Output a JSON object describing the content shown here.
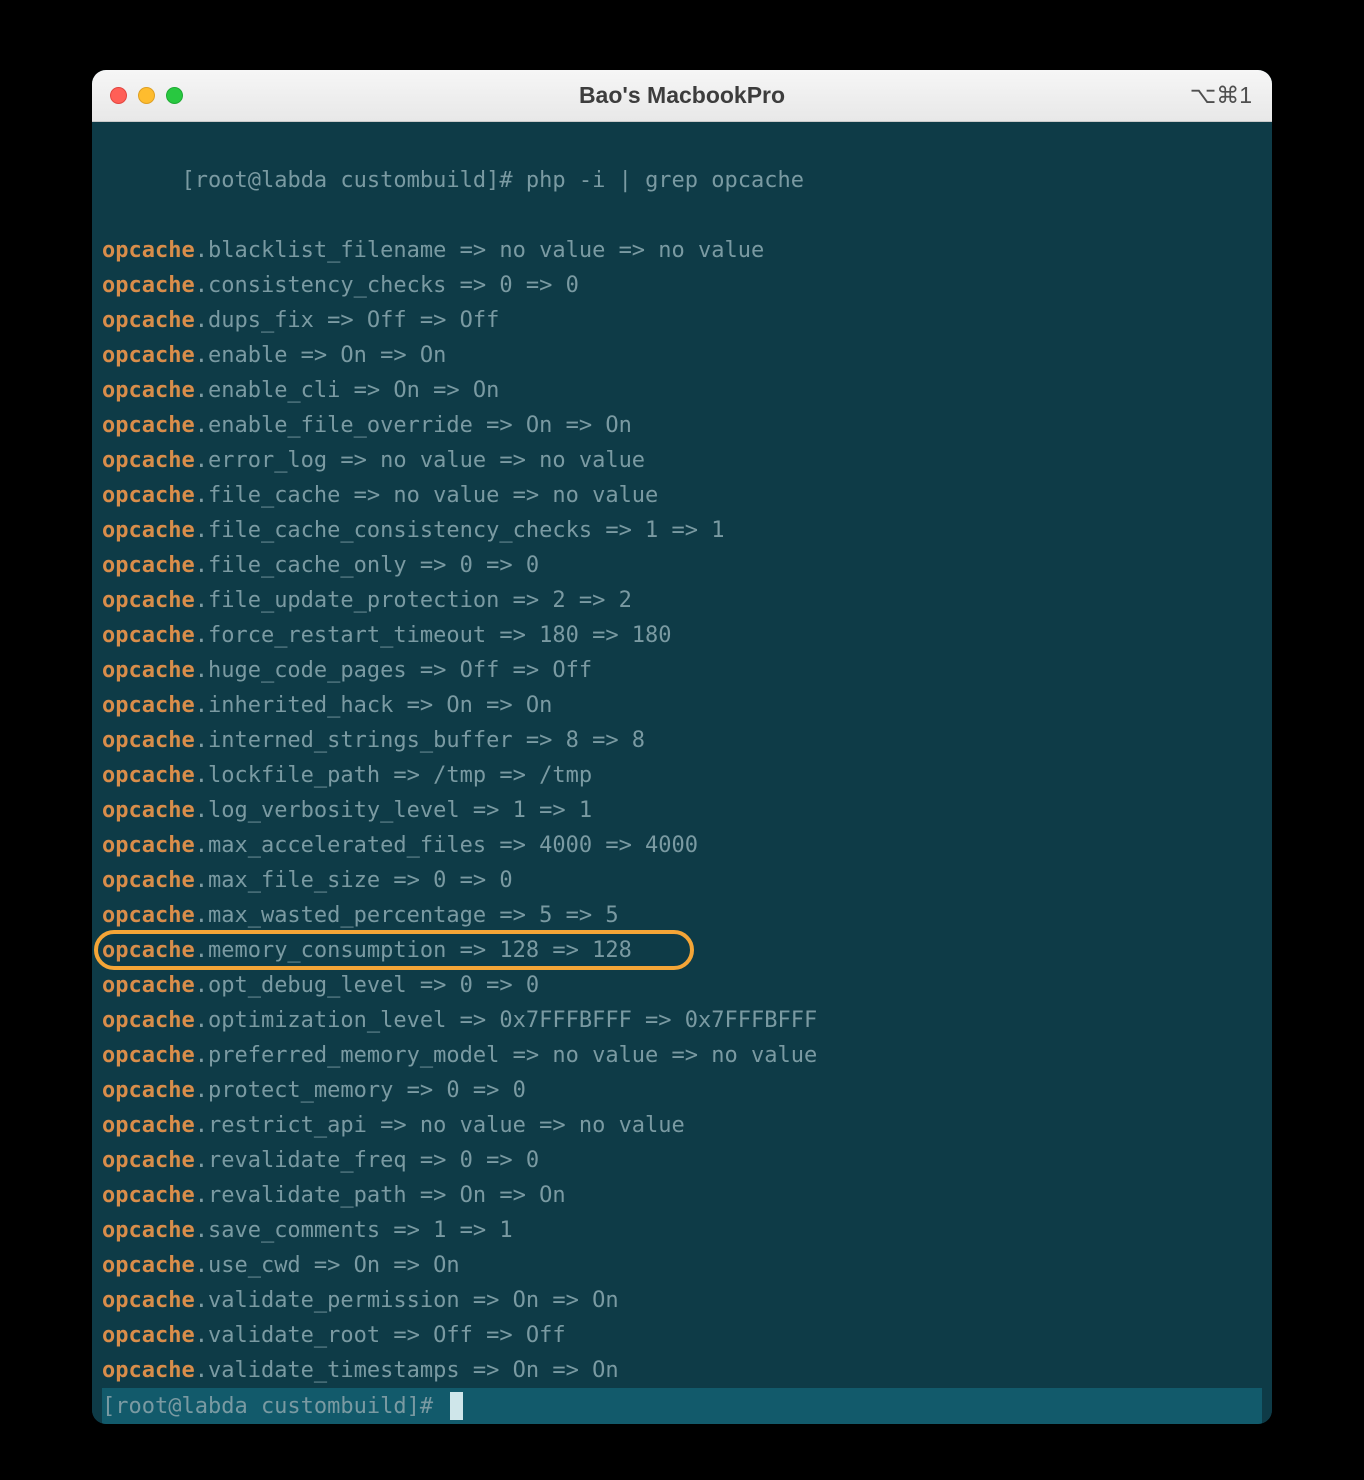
{
  "titlebar": {
    "title": "Bao's MacbookPro",
    "shortcut": "⌥⌘1"
  },
  "prompt_line": "[root@labda custombuild]# php -i | grep opcache",
  "prompt_end": "[root@labda custombuild]# ",
  "highlight_key": "opcache",
  "lines": [
    {
      "rest": ".blacklist_filename => no value => no value"
    },
    {
      "rest": ".consistency_checks => 0 => 0"
    },
    {
      "rest": ".dups_fix => Off => Off"
    },
    {
      "rest": ".enable => On => On"
    },
    {
      "rest": ".enable_cli => On => On"
    },
    {
      "rest": ".enable_file_override => On => On"
    },
    {
      "rest": ".error_log => no value => no value"
    },
    {
      "rest": ".file_cache => no value => no value"
    },
    {
      "rest": ".file_cache_consistency_checks => 1 => 1"
    },
    {
      "rest": ".file_cache_only => 0 => 0"
    },
    {
      "rest": ".file_update_protection => 2 => 2"
    },
    {
      "rest": ".force_restart_timeout => 180 => 180"
    },
    {
      "rest": ".huge_code_pages => Off => Off"
    },
    {
      "rest": ".inherited_hack => On => On"
    },
    {
      "rest": ".interned_strings_buffer => 8 => 8"
    },
    {
      "rest": ".lockfile_path => /tmp => /tmp"
    },
    {
      "rest": ".log_verbosity_level => 1 => 1"
    },
    {
      "rest": ".max_accelerated_files => 4000 => 4000"
    },
    {
      "rest": ".max_file_size => 0 => 0"
    },
    {
      "rest": ".max_wasted_percentage => 5 => 5"
    },
    {
      "rest": ".memory_consumption => 128 => 128",
      "ring": true,
      "ring_width": 600
    },
    {
      "rest": ".opt_debug_level => 0 => 0"
    },
    {
      "rest": ".optimization_level => 0x7FFFBFFF => 0x7FFFBFFF"
    },
    {
      "rest": ".preferred_memory_model => no value => no value"
    },
    {
      "rest": ".protect_memory => 0 => 0"
    },
    {
      "rest": ".restrict_api => no value => no value"
    },
    {
      "rest": ".revalidate_freq => 0 => 0"
    },
    {
      "rest": ".revalidate_path => On => On"
    },
    {
      "rest": ".save_comments => 1 => 1"
    },
    {
      "rest": ".use_cwd => On => On"
    },
    {
      "rest": ".validate_permission => On => On"
    },
    {
      "rest": ".validate_root => Off => Off"
    },
    {
      "rest": ".validate_timestamps => On => On"
    }
  ]
}
